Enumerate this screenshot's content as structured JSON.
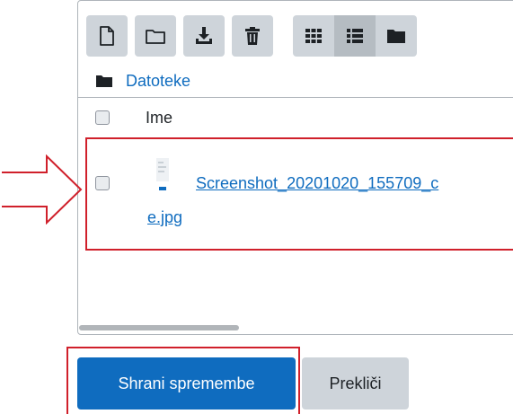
{
  "toolbar": {
    "buttons": [
      {
        "icon": "new-file-icon"
      },
      {
        "icon": "new-folder-icon"
      },
      {
        "icon": "download-icon"
      },
      {
        "icon": "delete-icon"
      }
    ],
    "view_buttons": [
      {
        "icon": "grid-view-icon",
        "active": false
      },
      {
        "icon": "list-view-icon",
        "active": true
      },
      {
        "icon": "folder-view-icon",
        "active": false
      }
    ]
  },
  "path": {
    "folder_icon": "folder-icon",
    "label": "Datoteke"
  },
  "table": {
    "column_name": "Ime"
  },
  "files": [
    {
      "name_line1": "Screenshot_20201020_155709_c",
      "name_line2": "e.jpg",
      "icon": "image-file-icon"
    }
  ],
  "actions": {
    "save_label": "Shrani spremembe",
    "cancel_label": "Prekliči"
  },
  "colors": {
    "primary": "#0f6cbf",
    "secondary": "#ced4da",
    "highlight": "#d0202b"
  }
}
